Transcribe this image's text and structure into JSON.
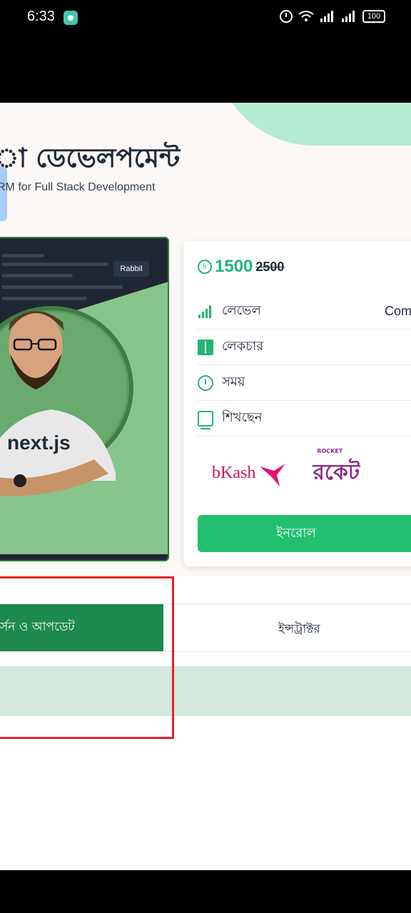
{
  "status_bar": {
    "time": "6:33",
    "battery": "100"
  },
  "course": {
    "title": "া ডেভেলপমেন্ট",
    "subtitle": "RM for Full Stack Development",
    "thumbnail_text": "next.js",
    "brand_badge": "Rabbil"
  },
  "pricing": {
    "current_price": "1500",
    "old_price": "2500",
    "currency_icon": "taka-icon",
    "rows": [
      {
        "label": "লেভেল",
        "value": "Com"
      },
      {
        "label": "লেকচার",
        "value": ""
      },
      {
        "label": "সময়",
        "value": ""
      },
      {
        "label": "শিখছেন",
        "value": ""
      }
    ],
    "payments": {
      "bkash": "bKash",
      "rocket": "রকেট",
      "rocket_small": "ROCKET"
    },
    "enroll_label": "ইনরোল"
  },
  "tabs": {
    "active_label": "র্সন ও আপডেট",
    "instructor_label": "ইন্সট্রাক্টর"
  },
  "colors": {
    "accent": "#22c06e",
    "active_tab": "#1e8a4c",
    "highlight": "#e02424"
  }
}
